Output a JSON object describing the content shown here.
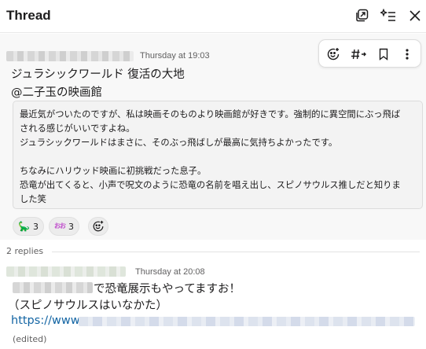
{
  "header": {
    "title": "Thread",
    "icons": [
      "open-in-window-icon",
      "notifications-settings-icon",
      "close-icon"
    ]
  },
  "parent": {
    "timestamp": "Thursday at 19:03",
    "title_line1": "ジュラシックワールド 復活の大地",
    "title_line2": "@二子玉の映画館",
    "quote_lines": [
      "最近気がついたのですが、私は映画そのものより映画館が好きです。強制的に異空間にぶっ飛ば",
      "される感じがいいですよね。",
      "ジュラシックワールドはまさに、そのぶっ飛ばしが最高に気持ちよかったです。",
      "",
      "ちなみにハリウッド映画に初挑戦だった息子。",
      "恐竜が出てくると、小声で呪文のように恐竜の名前を唱え出し、スピノサウルス推しだと知りま",
      "した笑"
    ],
    "reactions": [
      {
        "emoji": "🦕",
        "count": "3"
      },
      {
        "emoji": "おお",
        "count": "3"
      }
    ],
    "toolbar": [
      "add-reaction-icon",
      "channel-icon",
      "bookmark-icon",
      "more-icon"
    ]
  },
  "replies": {
    "label": "2 replies",
    "timestamp": "Thursday at 20:08",
    "line1": "で恐竜展示もやってますお！",
    "line2": "（スピノサウルスはいなかた）",
    "link_prefix": "https://www.",
    "edited": "(edited)"
  },
  "colors": {
    "link": "#1264a3",
    "text": "#1d1c1d",
    "muted": "#616061",
    "thread_bg": "#f8f8f8"
  }
}
